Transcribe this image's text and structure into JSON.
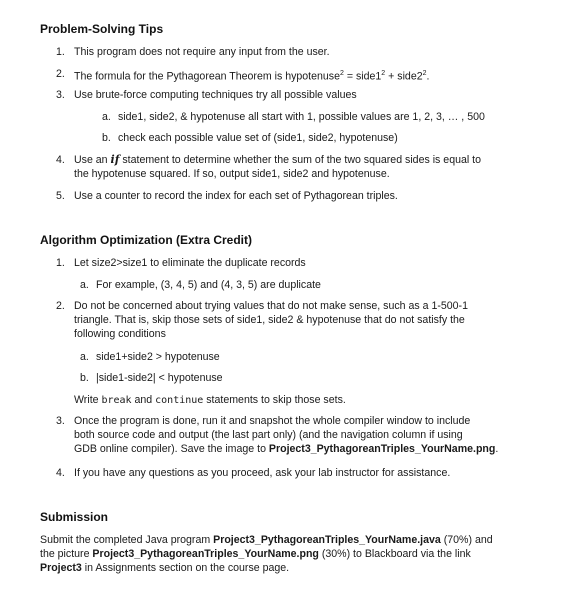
{
  "sections": {
    "tips": {
      "heading": "Problem-Solving Tips",
      "items": [
        {
          "num": "1.",
          "text": "This program does not require any input from the user."
        },
        {
          "num": "2.",
          "text_before": "The formula for the Pythagorean Theorem is hypotenuse",
          "sup": "2",
          "mid1": " = side1",
          "mid2": " + side2",
          "end": "."
        },
        {
          "num": "3.",
          "text": "Use brute-force computing techniques try all possible values",
          "subitems": [
            {
              "num": "a.",
              "text": "side1, side2, & hypotenuse all start with 1, possible values are 1, 2, 3, … , 500"
            },
            {
              "num": "b.",
              "text": "check each possible value set of (side1, side2, hypotenuse)"
            }
          ]
        },
        {
          "num": "4.",
          "text_before": "Use an ",
          "keyword": "if",
          "text_after": " statement to determine whether the sum of the two squared sides is equal to",
          "line2": "the hypotenuse squared. If so, output side1, side2 and hypotenuse."
        },
        {
          "num": "5.",
          "text": "Use a counter to record the index for each set of Pythagorean triples."
        }
      ]
    },
    "optimization": {
      "heading": "Algorithm Optimization (Extra Credit)",
      "items": [
        {
          "num": "1.",
          "text": "Let size2>size1 to eliminate the duplicate records",
          "subitems": [
            {
              "num": "a.",
              "text": "For example, (3, 4, 5) and (4, 3, 5) are duplicate"
            }
          ]
        },
        {
          "num": "2.",
          "line1": "Do not be concerned about trying values that do not make sense, such as a 1-500-1",
          "line2": "triangle. That is, skip those sets of side1, side2 & hypotenuse that do not satisfy the",
          "line3": "following conditions",
          "subitems": [
            {
              "num": "a.",
              "text": "side1+side2 > hypotenuse"
            },
            {
              "num": "b.",
              "text": "|side1-side2| < hypotenuse"
            }
          ],
          "note_before": "Write ",
          "kw1": "break",
          "note_mid": " and ",
          "kw2": "continue",
          "note_after": " statements to skip those sets."
        },
        {
          "num": "3.",
          "line1": "Once the program is done, run it and snapshot the whole compiler window to include",
          "line2": "both source code and output (the last part only) (and the navigation column if using",
          "line3_before": "GDB online compiler). Save the image to ",
          "line3_bold": "Project3_PythagoreanTriples_YourName.png",
          "line3_after": "."
        },
        {
          "num": "4.",
          "text": "If you have any questions as you proceed, ask your lab instructor for assistance."
        }
      ]
    },
    "submission": {
      "heading": "Submission",
      "p1_before": "Submit the completed Java program ",
      "p1_bold": "Project3_PythagoreanTriples_YourName.java",
      "p1_after": " (70%) and",
      "p2_before": "the picture ",
      "p2_bold": "Project3_PythagoreanTriples_YourName.png",
      "p2_after": " (30%) to Blackboard via the link",
      "p3_bold": "Project3",
      "p3_after": " in Assignments section on the course page."
    }
  }
}
